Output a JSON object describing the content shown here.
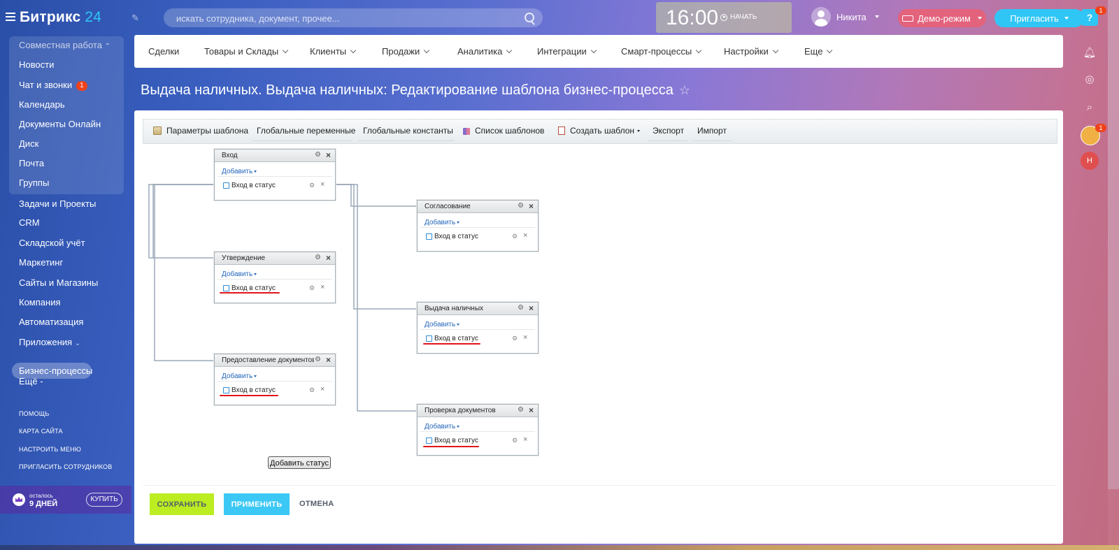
{
  "header": {
    "logo_main": "Битрикс",
    "logo_num": "24",
    "search_placeholder": "искать сотрудника, документ, прочее...",
    "clock_time": "16:00",
    "clock_action": "НАЧАТЬ",
    "user_name": "Никита",
    "demo_label": "Демо-режим",
    "invite_label": "Пригласить"
  },
  "rail": {
    "help_label": "?",
    "help_badge": "1",
    "avatar_badge": "1",
    "avatar2_letter": "Н"
  },
  "sidebar": {
    "group_title": "Совместная работа",
    "items": [
      {
        "label": "Новости"
      },
      {
        "label": "Чат и звонки",
        "count": "1"
      },
      {
        "label": "Календарь"
      },
      {
        "label": "Документы Онлайн"
      },
      {
        "label": "Диск"
      },
      {
        "label": "Почта"
      },
      {
        "label": "Группы"
      },
      {
        "label": "Задачи и Проекты"
      },
      {
        "label": "CRM"
      },
      {
        "label": "Складской учёт"
      },
      {
        "label": "Маркетинг"
      },
      {
        "label": "Сайты и Магазины"
      },
      {
        "label": "Компания"
      },
      {
        "label": "Автоматизация"
      },
      {
        "label": "Приложения"
      },
      {
        "label": "Бизнес-процессы"
      },
      {
        "label": "Ещё -"
      }
    ],
    "small_links": [
      "ПОМОЩЬ",
      "КАРТА САЙТА",
      "НАСТРОИТЬ МЕНЮ",
      "ПРИГЛАСИТЬ СОТРУДНИКОВ"
    ],
    "trial_line1": "осталось",
    "trial_line2": "9 ДНЕЙ",
    "buy_label": "КУПИТЬ"
  },
  "nav": [
    "Сделки",
    "Товары и Склады",
    "Клиенты",
    "Продажи",
    "Аналитика",
    "Интеграции",
    "Смарт-процессы",
    "Настройки",
    "Еще"
  ],
  "page_title": "Выдача наличных. Выдача наличных: Редактирование шаблона бизнес-процесса",
  "toolbar": [
    "Параметры шаблона",
    "Глобальные переменные",
    "Глобальные константы",
    "Список шаблонов",
    "Создать шаблон",
    "Экспорт",
    "Импорт"
  ],
  "states": [
    {
      "title": "Вход",
      "add": "Добавить",
      "action": "Вход в статус"
    },
    {
      "title": "Утверждение",
      "add": "Добавить",
      "action": "Вход в статус"
    },
    {
      "title": "Предоставление документов",
      "add": "Добавить",
      "action": "Вход в статус"
    },
    {
      "title": "Согласование",
      "add": "Добавить",
      "action": "Вход в статус"
    },
    {
      "title": "Выдача наличных",
      "add": "Добавить",
      "action": "Вход в статус"
    },
    {
      "title": "Проверка документов",
      "add": "Добавить",
      "action": "Вход в статус"
    }
  ],
  "add_status_label": "Добавить статус",
  "footer": {
    "save": "СОХРАНИТЬ",
    "apply": "ПРИМЕНИТЬ",
    "cancel": "ОТМЕНА"
  }
}
